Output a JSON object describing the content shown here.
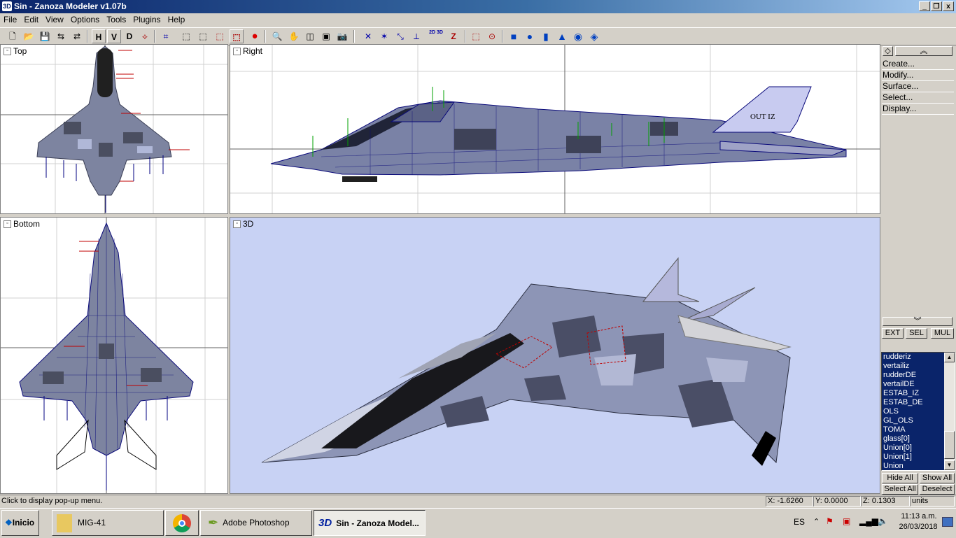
{
  "window": {
    "title": "Sin - Zanoza Modeler v1.07b",
    "icon_text": "3D",
    "min": "_",
    "restore": "❐",
    "close": "x"
  },
  "menu": [
    "File",
    "Edit",
    "View",
    "Options",
    "Tools",
    "Plugins",
    "Help"
  ],
  "toolbar": {
    "h_label": "H",
    "v_label": "V",
    "d_label": "D",
    "flag_label": "2D 3D",
    "z_label": "Z"
  },
  "viewports": {
    "top": "Top",
    "right": "Right",
    "bottom": "Bottom",
    "threed": "3D"
  },
  "right_panel_text": "OUT IZ",
  "sidepanel": {
    "menu_items": [
      "Create...",
      "Modify...",
      "Surface...",
      "Select...",
      "Display..."
    ],
    "mode_buttons": [
      "EXT",
      "SEL",
      "MUL"
    ],
    "objects": [
      "rudderiz",
      "vertailiz",
      "rudderDE",
      "vertailDE",
      "ESTAB_IZ",
      "ESTAB_DE",
      "OLS",
      "GL_OLS",
      "TOMA",
      "glass[0]",
      "Union[0]",
      "Union[1]",
      "Union"
    ],
    "hide_all": "Hide All",
    "show_all": "Show All",
    "select_all": "Select All",
    "deselect": "Deselect"
  },
  "status": {
    "message": "Click to display pop-up menu.",
    "x": "X: -1.6260",
    "y": "Y: 0.0000",
    "z": "Z: 0.1303",
    "units": "units"
  },
  "taskbar": {
    "start": "Inicio",
    "items": [
      {
        "label": "MIG-41"
      },
      {
        "label": ""
      },
      {
        "label": "Adobe Photoshop"
      },
      {
        "label": "Sin - Zanoza Model..."
      }
    ],
    "lang": "ES",
    "time": "11:13 a.m.",
    "date": "26/03/2018"
  },
  "colors": {
    "viewport3d_bg": "#c8d2f4",
    "wire": "#0a0a7a",
    "camo_light": "#9aa3c2",
    "camo_dark": "#4a4e60",
    "accent": "#0a246a"
  }
}
